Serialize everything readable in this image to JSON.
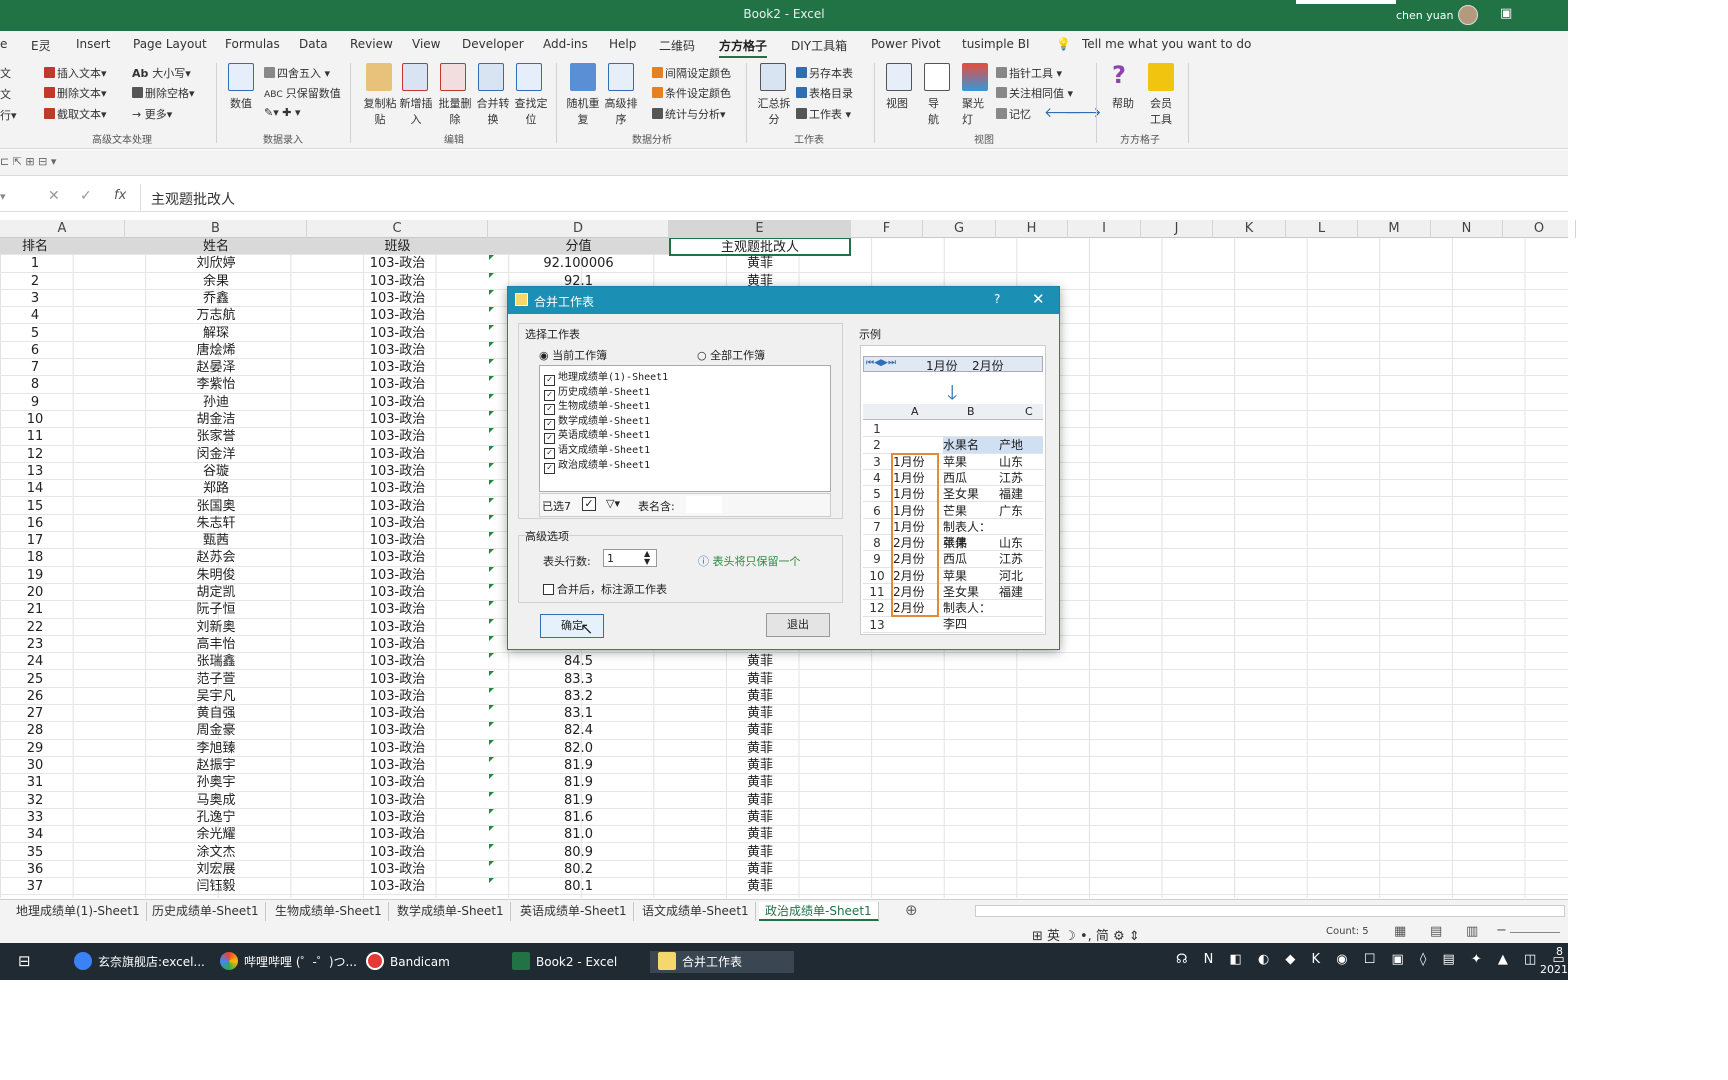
{
  "window": {
    "title": "Book2  -  Excel",
    "user": "chen yuan"
  },
  "tabs": [
    "e",
    "E灵",
    "Insert",
    "Page Layout",
    "Formulas",
    "Data",
    "Review",
    "View",
    "Developer",
    "Add-ins",
    "Help",
    "二维码",
    "方方格子",
    "DIY工具箱",
    "Power Pivot",
    "tusimple BI"
  ],
  "active_tab": "方方格子",
  "tell_me": "Tell me what you want to do",
  "ribbon": {
    "g1": {
      "items": [
        "插入文本",
        "删除文本",
        "截取文本",
        "大小写",
        "删除空格",
        "更多"
      ],
      "label": "高级文本处理"
    },
    "g2": {
      "items": [
        "数值",
        "四舍五入",
        "只保留数值"
      ],
      "label": "数据录入"
    },
    "g3": {
      "items": [
        "复制粘贴",
        "新增插入",
        "批量删除",
        "合并转换",
        "查找定位"
      ],
      "label": "编辑"
    },
    "g4": {
      "items": [
        "随机重复",
        "高级排序",
        "间隔设定颜色",
        "条件设定颜色",
        "统计与分析"
      ],
      "label": "数据分析"
    },
    "g5": {
      "items": [
        "汇总拆分",
        "另存本表",
        "表格目录",
        "工作表"
      ],
      "label": "工作表"
    },
    "g6": {
      "items": [
        "视图",
        "导航",
        "聚光灯",
        "指针工具",
        "关注相同值",
        "记忆"
      ],
      "label": "视图"
    },
    "g7": {
      "items": [
        "帮助",
        "会员工具"
      ],
      "label": "方方格子"
    }
  },
  "formula": {
    "value": "主观题批改人",
    "fx": "fx"
  },
  "columns": [
    "A",
    "B",
    "C",
    "D",
    "E",
    "F",
    "G",
    "H",
    "I",
    "J",
    "K",
    "L",
    "M",
    "N",
    "O"
  ],
  "header_row": [
    "排名",
    "姓名",
    "班级",
    "分值",
    "主观题批改人"
  ],
  "rows": [
    [
      "1",
      "刘欣婷",
      "103-政治",
      "92.100006",
      "黄菲"
    ],
    [
      "2",
      "余果",
      "103-政治",
      "92.1",
      "黄菲"
    ],
    [
      "3",
      "乔鑫",
      "103-政治",
      "",
      ""
    ],
    [
      "4",
      "万志航",
      "103-政治",
      "",
      ""
    ],
    [
      "5",
      "解琛",
      "103-政治",
      "",
      ""
    ],
    [
      "6",
      "唐烩烯",
      "103-政治",
      "",
      ""
    ],
    [
      "7",
      "赵晏泽",
      "103-政治",
      "",
      ""
    ],
    [
      "8",
      "李紫怡",
      "103-政治",
      "",
      ""
    ],
    [
      "9",
      "孙迪",
      "103-政治",
      "",
      ""
    ],
    [
      "10",
      "胡金洁",
      "103-政治",
      "",
      ""
    ],
    [
      "11",
      "张家誉",
      "103-政治",
      "",
      ""
    ],
    [
      "12",
      "闵金洋",
      "103-政治",
      "",
      ""
    ],
    [
      "13",
      "谷璇",
      "103-政治",
      "",
      ""
    ],
    [
      "14",
      "郑路",
      "103-政治",
      "",
      ""
    ],
    [
      "15",
      "张国奥",
      "103-政治",
      "",
      ""
    ],
    [
      "16",
      "朱志轩",
      "103-政治",
      "",
      ""
    ],
    [
      "17",
      "甄茜",
      "103-政治",
      "",
      ""
    ],
    [
      "18",
      "赵苏会",
      "103-政治",
      "",
      ""
    ],
    [
      "19",
      "朱明俊",
      "103-政治",
      "",
      ""
    ],
    [
      "20",
      "胡定凯",
      "103-政治",
      "",
      ""
    ],
    [
      "21",
      "阮子恒",
      "103-政治",
      "",
      ""
    ],
    [
      "22",
      "刘新奥",
      "103-政治",
      "",
      ""
    ],
    [
      "23",
      "高丰怡",
      "103-政治",
      "",
      ""
    ],
    [
      "24",
      "张瑞鑫",
      "103-政治",
      "84.5",
      "黄菲"
    ],
    [
      "25",
      "范子萱",
      "103-政治",
      "83.3",
      "黄菲"
    ],
    [
      "26",
      "吴宇凡",
      "103-政治",
      "83.2",
      "黄菲"
    ],
    [
      "27",
      "黄自强",
      "103-政治",
      "83.1",
      "黄菲"
    ],
    [
      "28",
      "周金豪",
      "103-政治",
      "82.4",
      "黄菲"
    ],
    [
      "29",
      "李旭臻",
      "103-政治",
      "82.0",
      "黄菲"
    ],
    [
      "30",
      "赵振宇",
      "103-政治",
      "81.9",
      "黄菲"
    ],
    [
      "31",
      "孙奥宇",
      "103-政治",
      "81.9",
      "黄菲"
    ],
    [
      "32",
      "马奥成",
      "103-政治",
      "81.9",
      "黄菲"
    ],
    [
      "33",
      "孔逸宁",
      "103-政治",
      "81.6",
      "黄菲"
    ],
    [
      "34",
      "余光耀",
      "103-政治",
      "81.0",
      "黄菲"
    ],
    [
      "35",
      "涂文杰",
      "103-政治",
      "80.9",
      "黄菲"
    ],
    [
      "36",
      "刘宏展",
      "103-政治",
      "80.2",
      "黄菲"
    ],
    [
      "37",
      "闫钰毅",
      "103-政治",
      "80.1",
      "黄菲"
    ]
  ],
  "dialog": {
    "title": "合并工作表",
    "help": "?",
    "select_label": "选择工作表",
    "radio_current": "当前工作簿",
    "radio_all": "全部工作簿",
    "sheets": [
      "地理成绩单(1)-Sheet1",
      "历史成绩单-Sheet1",
      "生物成绩单-Sheet1",
      "数学成绩单-Sheet1",
      "英语成绩单-Sheet1",
      "语文成绩单-Sheet1",
      "政治成绩单-Sheet1"
    ],
    "selected_count": "已选7",
    "table_name_label": "表名含:",
    "advanced_label": "高级选项",
    "header_rows_label": "表头行数:",
    "header_rows_value": "1",
    "header_hint": "表头将只保留一个",
    "mark_source": "合并后，标注源工作表",
    "ok": "确定",
    "exit": "退出",
    "example_label": "示例",
    "example_tabs": [
      "1月份",
      "2月份"
    ],
    "example_cols": [
      "A",
      "B",
      "C"
    ],
    "example_rows": [
      [
        "1",
        "",
        "",
        ""
      ],
      [
        "2",
        "",
        "水果名",
        "产地"
      ],
      [
        "3",
        "1月份",
        "苹果",
        "山东"
      ],
      [
        "4",
        "1月份",
        "西瓜",
        "江苏"
      ],
      [
        "5",
        "1月份",
        "圣女果",
        "福建"
      ],
      [
        "6",
        "1月份",
        "芒果",
        "广东"
      ],
      [
        "7",
        "1月份",
        "制表人：张伟",
        ""
      ],
      [
        "8",
        "2月份",
        "苹果",
        "山东"
      ],
      [
        "9",
        "2月份",
        "西瓜",
        "江苏"
      ],
      [
        "10",
        "2月份",
        "苹果",
        "河北"
      ],
      [
        "11",
        "2月份",
        "圣女果",
        "福建"
      ],
      [
        "12",
        "2月份",
        "制表人：李四",
        ""
      ],
      [
        "13",
        "",
        "",
        ""
      ]
    ]
  },
  "sheet_tabs": [
    "地理成绩单(1)-Sheet1",
    "历史成绩单-Sheet1",
    "生物成绩单-Sheet1",
    "数学成绩单-Sheet1",
    "英语成绩单-Sheet1",
    "语文成绩单-Sheet1",
    "政治成绩单-Sheet1"
  ],
  "active_sheet": "政治成绩单-Sheet1",
  "status": {
    "count": "Count: 5",
    "ime": "英",
    "ime2": "简"
  },
  "taskbar": [
    "玄奈旗舰店:excel...",
    "哔哩哔哩 (゜-゜)つ...",
    "Bandicam",
    "Book2 - Excel",
    "合并工作表"
  ],
  "clock": {
    "line1": "8",
    "line2": "2021"
  }
}
